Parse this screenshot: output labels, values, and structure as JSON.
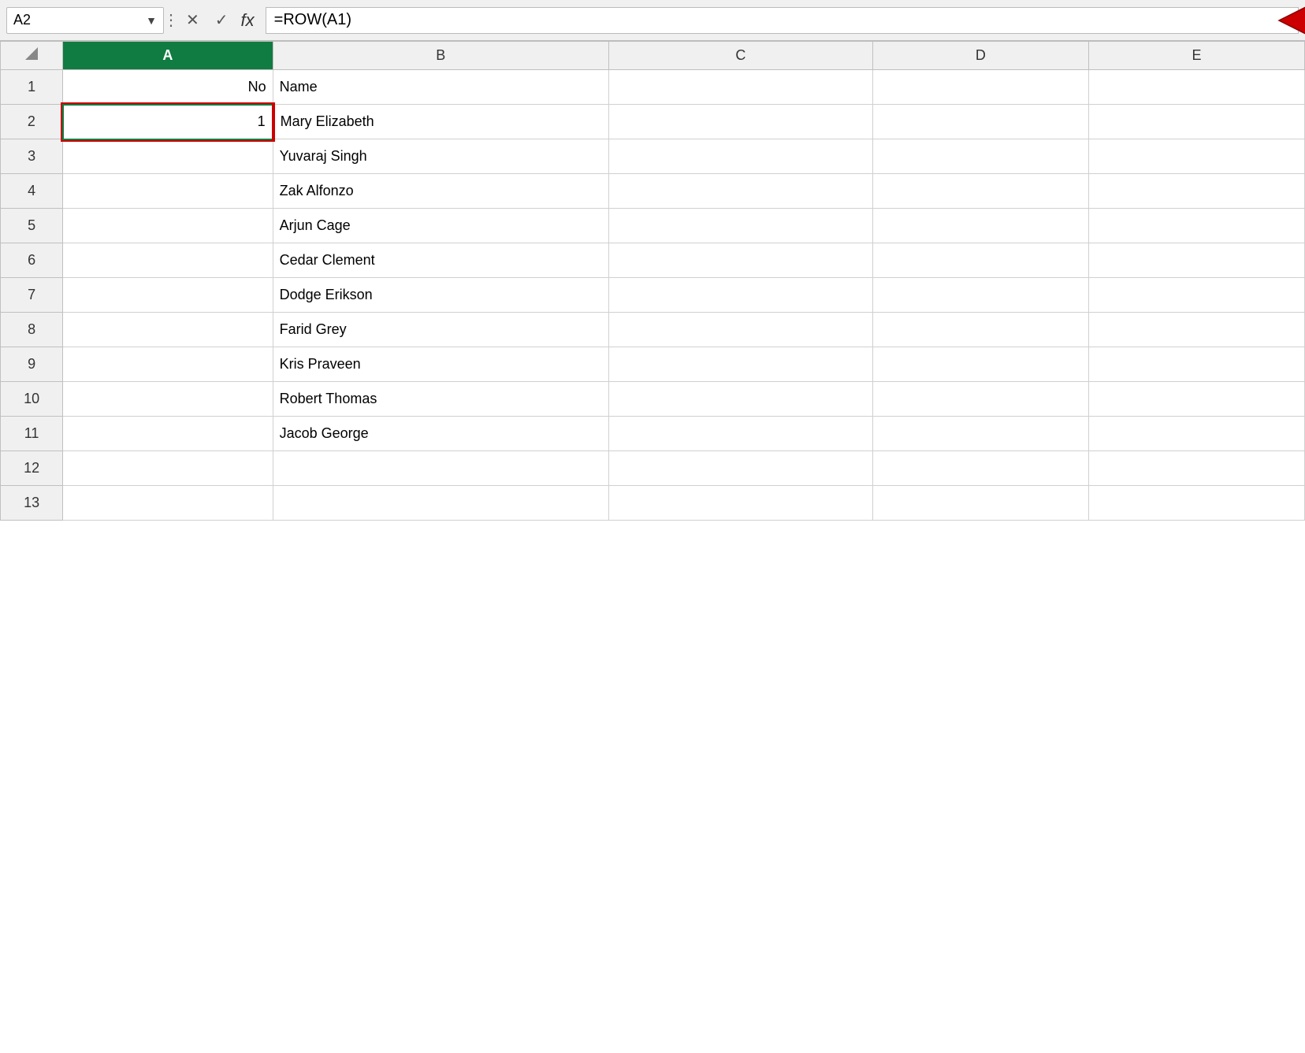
{
  "namebox": {
    "value": "A2",
    "dropdown_icon": "▼"
  },
  "formula_bar": {
    "cancel_label": "✕",
    "confirm_label": "✓",
    "fx_label": "fx",
    "formula_value": "=ROW(A1)"
  },
  "grid": {
    "columns": [
      "A",
      "B",
      "C",
      "D",
      "E"
    ],
    "active_column": "A",
    "rows": [
      {
        "row_num": "",
        "cells": [
          "A",
          "B",
          "C",
          "D",
          "E"
        ]
      },
      {
        "row_num": "1",
        "cells": [
          "No",
          "Name",
          "",
          "",
          ""
        ]
      },
      {
        "row_num": "2",
        "cells": [
          "1",
          "Mary Elizabeth",
          "",
          "",
          ""
        ]
      },
      {
        "row_num": "3",
        "cells": [
          "",
          "Yuvaraj Singh",
          "",
          "",
          ""
        ]
      },
      {
        "row_num": "4",
        "cells": [
          "",
          "Zak Alfonzo",
          "",
          "",
          ""
        ]
      },
      {
        "row_num": "5",
        "cells": [
          "",
          "Arjun Cage",
          "",
          "",
          ""
        ]
      },
      {
        "row_num": "6",
        "cells": [
          "",
          "Cedar Clement",
          "",
          "",
          ""
        ]
      },
      {
        "row_num": "7",
        "cells": [
          "",
          "Dodge Erikson",
          "",
          "",
          ""
        ]
      },
      {
        "row_num": "8",
        "cells": [
          "",
          "Farid Grey",
          "",
          "",
          ""
        ]
      },
      {
        "row_num": "9",
        "cells": [
          "",
          "Kris Praveen",
          "",
          "",
          ""
        ]
      },
      {
        "row_num": "10",
        "cells": [
          "",
          "Robert Thomas",
          "",
          "",
          ""
        ]
      },
      {
        "row_num": "11",
        "cells": [
          "",
          "Jacob George",
          "",
          "",
          ""
        ]
      },
      {
        "row_num": "12",
        "cells": [
          "",
          "",
          "",
          "",
          ""
        ]
      },
      {
        "row_num": "13",
        "cells": [
          "",
          "",
          "",
          "",
          ""
        ]
      }
    ]
  }
}
